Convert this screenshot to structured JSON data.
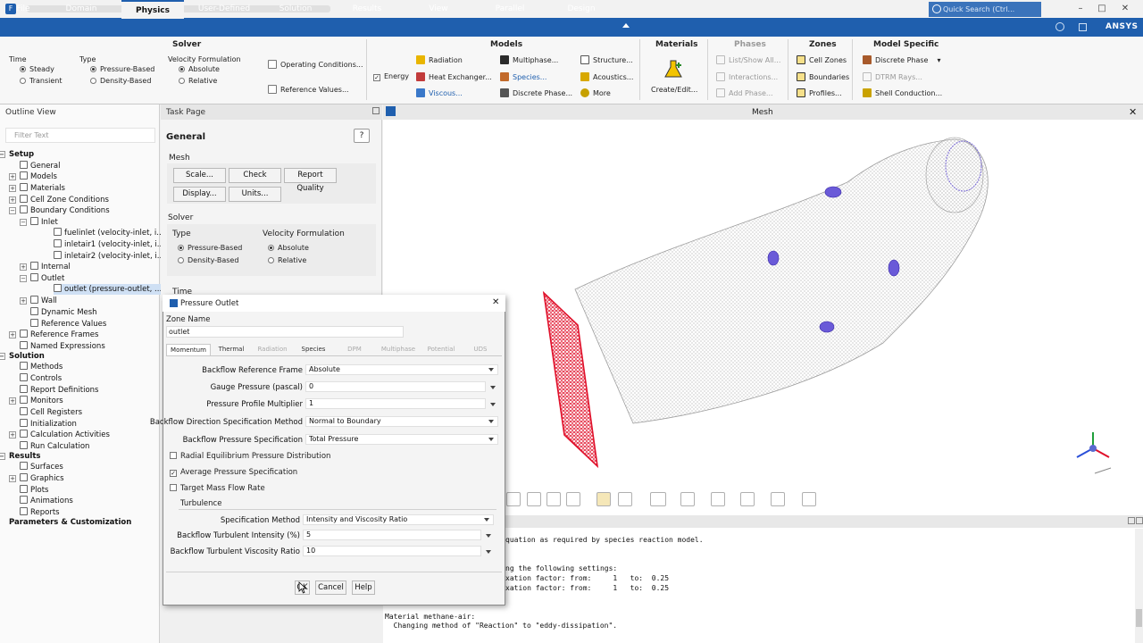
{
  "menu": {
    "tabs": [
      "File",
      "Domain",
      "Physics",
      "User-Defined",
      "Solution",
      "Results",
      "View",
      "Parallel",
      "Design"
    ],
    "active": "Physics",
    "search_placeholder": "Quick Search (Ctrl...",
    "logo": "ANSYS"
  },
  "ribbon": {
    "solver_title": "Solver",
    "time_label": "Time",
    "time_steady": "Steady",
    "time_transient": "Transient",
    "type_label": "Type",
    "type_pressure": "Pressure-Based",
    "type_density": "Density-Based",
    "velocity_label": "Velocity Formulation",
    "velocity_absolute": "Absolute",
    "velocity_relative": "Relative",
    "operating_conditions": "Operating Conditions...",
    "reference_values": "Reference Values...",
    "models_title": "Models",
    "energy": "Energy",
    "radiation": "Radiation",
    "heat_exchanger": "Heat Exchanger...",
    "viscous": "Viscous...",
    "multiphase": "Multiphase...",
    "species": "Species...",
    "discrete_phase": "Discrete Phase...",
    "structure": "Structure...",
    "acoustics": "Acoustics...",
    "more": "More",
    "materials_title": "Materials",
    "create_edit": "Create/Edit...",
    "phases_title": "Phases",
    "list_show_all": "List/Show All...",
    "interactions": "Interactions...",
    "add_phase": "Add Phase...",
    "zones_title": "Zones",
    "cell_zones": "Cell Zones",
    "boundaries": "Boundaries",
    "profiles": "Profiles...",
    "model_specific_title": "Model Specific",
    "ms_discrete_phase": "Discrete Phase",
    "dtrm_rays": "DTRM Rays...",
    "shell_conduction": "Shell Conduction..."
  },
  "outline": {
    "title": "Outline View",
    "filter_placeholder": "Filter Text",
    "items": [
      {
        "label": "Setup",
        "bold": true
      },
      {
        "label": "General"
      },
      {
        "label": "Models"
      },
      {
        "label": "Materials"
      },
      {
        "label": "Cell Zone Conditions"
      },
      {
        "label": "Boundary Conditions"
      },
      {
        "label": "Inlet"
      },
      {
        "label": "fuelinlet (velocity-inlet, i..."
      },
      {
        "label": "inletair1 (velocity-inlet, i..."
      },
      {
        "label": "inletair2 (velocity-inlet, i..."
      },
      {
        "label": "Internal"
      },
      {
        "label": "Outlet"
      },
      {
        "label": "outlet (pressure-outlet, ..."
      },
      {
        "label": "Wall"
      },
      {
        "label": "Dynamic Mesh"
      },
      {
        "label": "Reference Values"
      },
      {
        "label": "Reference Frames"
      },
      {
        "label": "Named Expressions"
      },
      {
        "label": "Solution",
        "bold": true
      },
      {
        "label": "Methods"
      },
      {
        "label": "Controls"
      },
      {
        "label": "Report Definitions"
      },
      {
        "label": "Monitors"
      },
      {
        "label": "Cell Registers"
      },
      {
        "label": "Initialization"
      },
      {
        "label": "Calculation Activities"
      },
      {
        "label": "Run Calculation"
      },
      {
        "label": "Results",
        "bold": true
      },
      {
        "label": "Surfaces"
      },
      {
        "label": "Graphics"
      },
      {
        "label": "Plots"
      },
      {
        "label": "Animations"
      },
      {
        "label": "Reports"
      },
      {
        "label": "Parameters & Customization",
        "bold": true
      }
    ]
  },
  "task": {
    "header": "Task Page",
    "title": "General",
    "mesh_label": "Mesh",
    "scale": "Scale...",
    "check": "Check",
    "report_quality": "Report Quality",
    "display": "Display...",
    "units": "Units...",
    "solver_label": "Solver",
    "type_label": "Type",
    "pressure_based": "Pressure-Based",
    "density_based": "Density-Based",
    "velocity_label": "Velocity Formulation",
    "absolute": "Absolute",
    "relative": "Relative",
    "time_label": "Time"
  },
  "mesh_view": {
    "title": "Mesh",
    "accent": "#5a3fd0",
    "outlet_color": "#e0102a"
  },
  "console": {
    "lines": [
      "quation as required by species reaction model.",
      "",
      "",
      "ng the following settings:",
      "xation factor: from:     1   to:  0.25",
      "xation factor: from:     1   to:  0.25",
      "",
      "",
      "Material methane-air:",
      "  Changing method of \"Reaction\" to \"eddy-dissipation\"."
    ]
  },
  "dialog": {
    "title": "Pressure Outlet",
    "zone_name_label": "Zone Name",
    "zone_name_value": "outlet",
    "tabs": [
      "Momentum",
      "Thermal",
      "Radiation",
      "Species",
      "DPM",
      "Multiphase",
      "Potential",
      "UDS"
    ],
    "active_tab": "Momentum",
    "backflow_ref_frame_label": "Backflow Reference Frame",
    "backflow_ref_frame_value": "Absolute",
    "gauge_pressure_label": "Gauge Pressure (pascal)",
    "gauge_pressure_value": "0",
    "pressure_profile_label": "Pressure Profile Multiplier",
    "pressure_profile_value": "1",
    "backflow_dir_label": "Backflow Direction Specification Method",
    "backflow_dir_value": "Normal to Boundary",
    "backflow_pressure_label": "Backflow Pressure Specification",
    "backflow_pressure_value": "Total Pressure",
    "radial_eq": "Radial Equilibrium Pressure Distribution",
    "avg_pressure": "Average Pressure Specification",
    "target_mass": "Target Mass Flow Rate",
    "turbulence_label": "Turbulence",
    "spec_method_label": "Specification Method",
    "spec_method_value": "Intensity and Viscosity Ratio",
    "turb_intensity_label": "Backflow Turbulent Intensity (%)",
    "turb_intensity_value": "5",
    "turb_viscosity_label": "Backflow Turbulent Viscosity Ratio",
    "turb_viscosity_value": "10",
    "ok": "OK",
    "cancel": "Cancel",
    "help": "Help"
  }
}
